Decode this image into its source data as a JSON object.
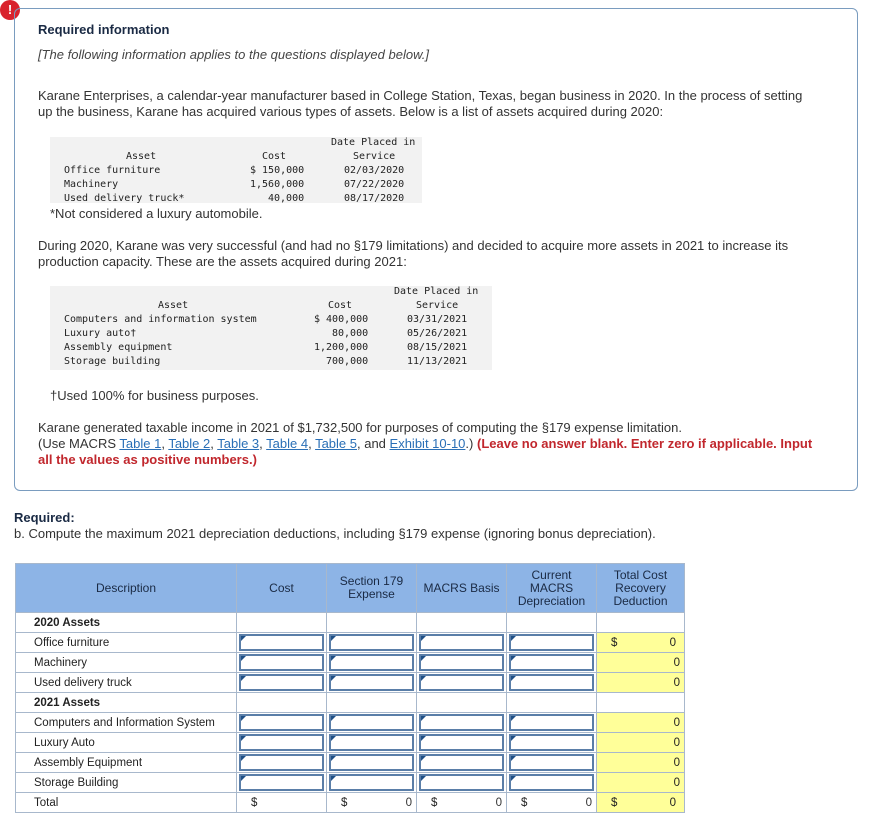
{
  "alert_glyph": "!",
  "info": {
    "title": "Required information",
    "applies": "[The following information applies to the questions displayed below.]",
    "intro": "Karane Enterprises, a calendar-year manufacturer based in College Station, Texas, began business in 2020. In the process of setting up the business, Karane has acquired various types of assets. Below is a list of assets acquired during 2020:",
    "table2020": {
      "headers": {
        "asset": "Asset",
        "cost": "Cost",
        "date_line1": "Date Placed in",
        "date_line2": "Service"
      },
      "rows": [
        {
          "asset": "Office furniture",
          "cost": "$ 150,000",
          "date": "02/03/2020"
        },
        {
          "asset": "Machinery",
          "cost": "1,560,000",
          "date": "07/22/2020"
        },
        {
          "asset": "Used delivery truck*",
          "cost": "40,000",
          "date": "08/17/2020"
        }
      ]
    },
    "footnote1": "*Not considered a luxury automobile.",
    "para2": "During 2020, Karane was very successful (and had no §179 limitations) and decided to acquire more assets in 2021 to increase its production capacity. These are the assets acquired during 2021:",
    "table2021": {
      "headers": {
        "asset": "Asset",
        "cost": "Cost",
        "date_line1": "Date Placed in",
        "date_line2": "Service"
      },
      "rows": [
        {
          "asset": "Computers and information system",
          "cost": "$ 400,000",
          "date": "03/31/2021"
        },
        {
          "asset": "Luxury auto†",
          "cost": "80,000",
          "date": "05/26/2021"
        },
        {
          "asset": "Assembly equipment",
          "cost": "1,200,000",
          "date": "08/15/2021"
        },
        {
          "asset": "Storage building",
          "cost": "700,000",
          "date": "11/13/2021"
        }
      ]
    },
    "footnote2": "†Used 100% for business purposes.",
    "para3": "Karane generated taxable income in 2021 of $1,732,500 for purposes of computing the §179 expense limitation.",
    "use_prefix": "(Use MACRS ",
    "links": [
      "Table 1",
      "Table 2",
      "Table 3",
      "Table 4",
      "Table 5",
      "Exhibit 10-10"
    ],
    "sep_comma": ", ",
    "sep_and": ", and ",
    "use_suffix": ".) ",
    "instruction": "(Leave no answer blank. Enter zero if applicable. Input all the values as positive numbers.)"
  },
  "required": {
    "heading": "Required:",
    "part_b": "b. Compute the maximum 2021 depreciation deductions, including §179 expense (ignoring bonus depreciation)."
  },
  "grid": {
    "headers": {
      "description": "Description",
      "cost": "Cost",
      "sec179_l1": "Section 179",
      "sec179_l2": "Expense",
      "macrs_basis": "MACRS Basis",
      "current_l1": "Current",
      "current_l2": "MACRS",
      "current_l3": "Depreciation",
      "total_l1": "Total Cost",
      "total_l2": "Recovery",
      "total_l3": "Deduction"
    },
    "section_2020": "2020 Assets",
    "section_2021": "2021 Assets",
    "rows_2020": [
      {
        "label": "Office furniture",
        "total": "0"
      },
      {
        "label": "Machinery",
        "total": "0"
      },
      {
        "label": "Used delivery truck",
        "total": "0"
      }
    ],
    "rows_2021": [
      {
        "label": "Computers and Information System",
        "total": "0"
      },
      {
        "label": "Luxury Auto",
        "total": "0"
      },
      {
        "label": "Assembly Equipment",
        "total": "0"
      },
      {
        "label": "Storage Building",
        "total": "0"
      }
    ],
    "dollar": "$",
    "total_row": {
      "label": "Total",
      "cost": "",
      "sec179": "0",
      "macrs_basis": "0",
      "current": "0",
      "total": "0"
    }
  }
}
